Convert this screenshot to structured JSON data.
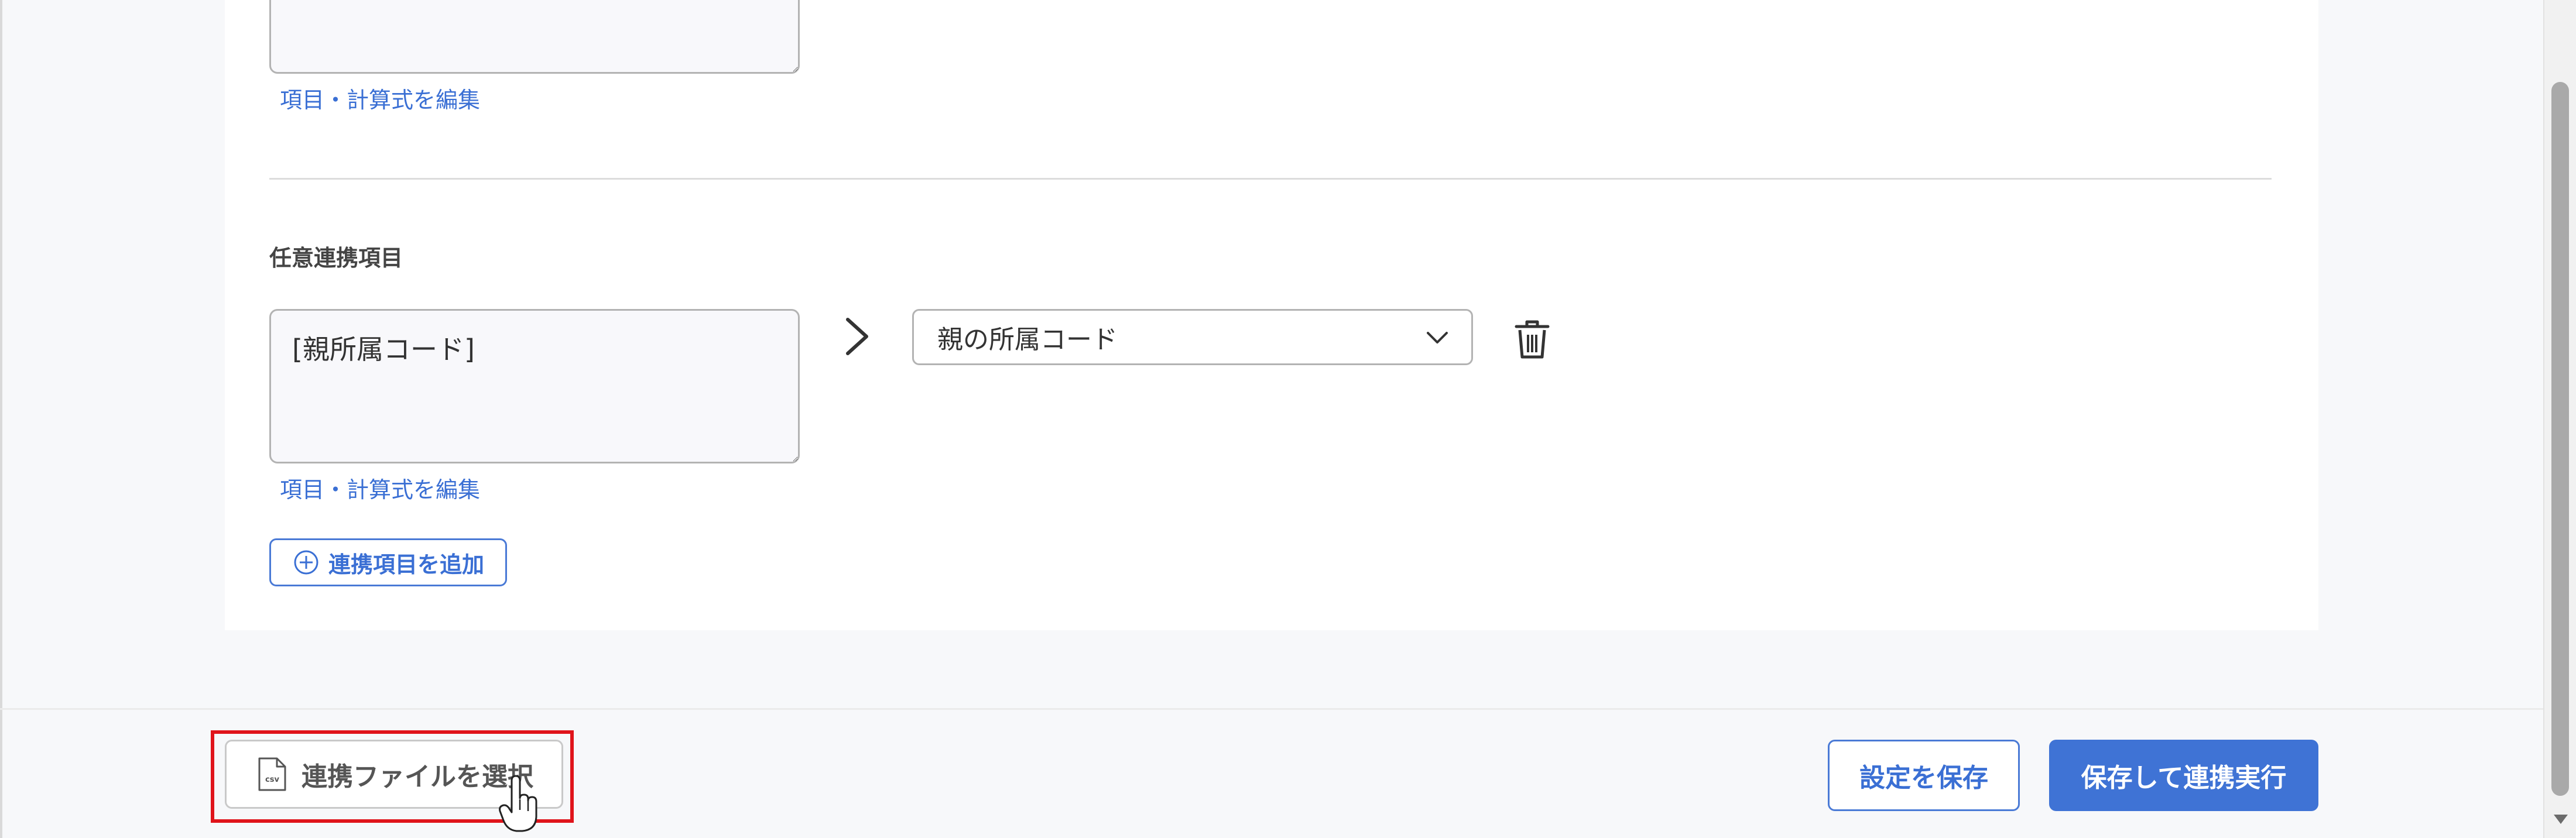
{
  "mapping_rows": [
    {
      "edit_link": "項目・計算式を編集"
    },
    {
      "source_value": "[親所属コード]",
      "target_value": "親の所属コード",
      "edit_link": "項目・計算式を編集"
    }
  ],
  "section": {
    "title": "任意連携項目"
  },
  "add_button": {
    "label": "連携項目を追加"
  },
  "footer": {
    "file_button_label": "連携ファイルを選択",
    "save_button_label": "設定を保存",
    "run_button_label": "保存して連携実行"
  },
  "icons": {
    "arrow": "chevron-right-icon",
    "select": "chevron-down-icon",
    "delete": "trash-icon",
    "add": "plus-circle-icon",
    "file": "csv-file-icon",
    "cursor": "hand-pointer-icon"
  },
  "colors": {
    "accent": "#3f73d5",
    "link": "#3a6fd4",
    "highlight": "#e0141b"
  }
}
